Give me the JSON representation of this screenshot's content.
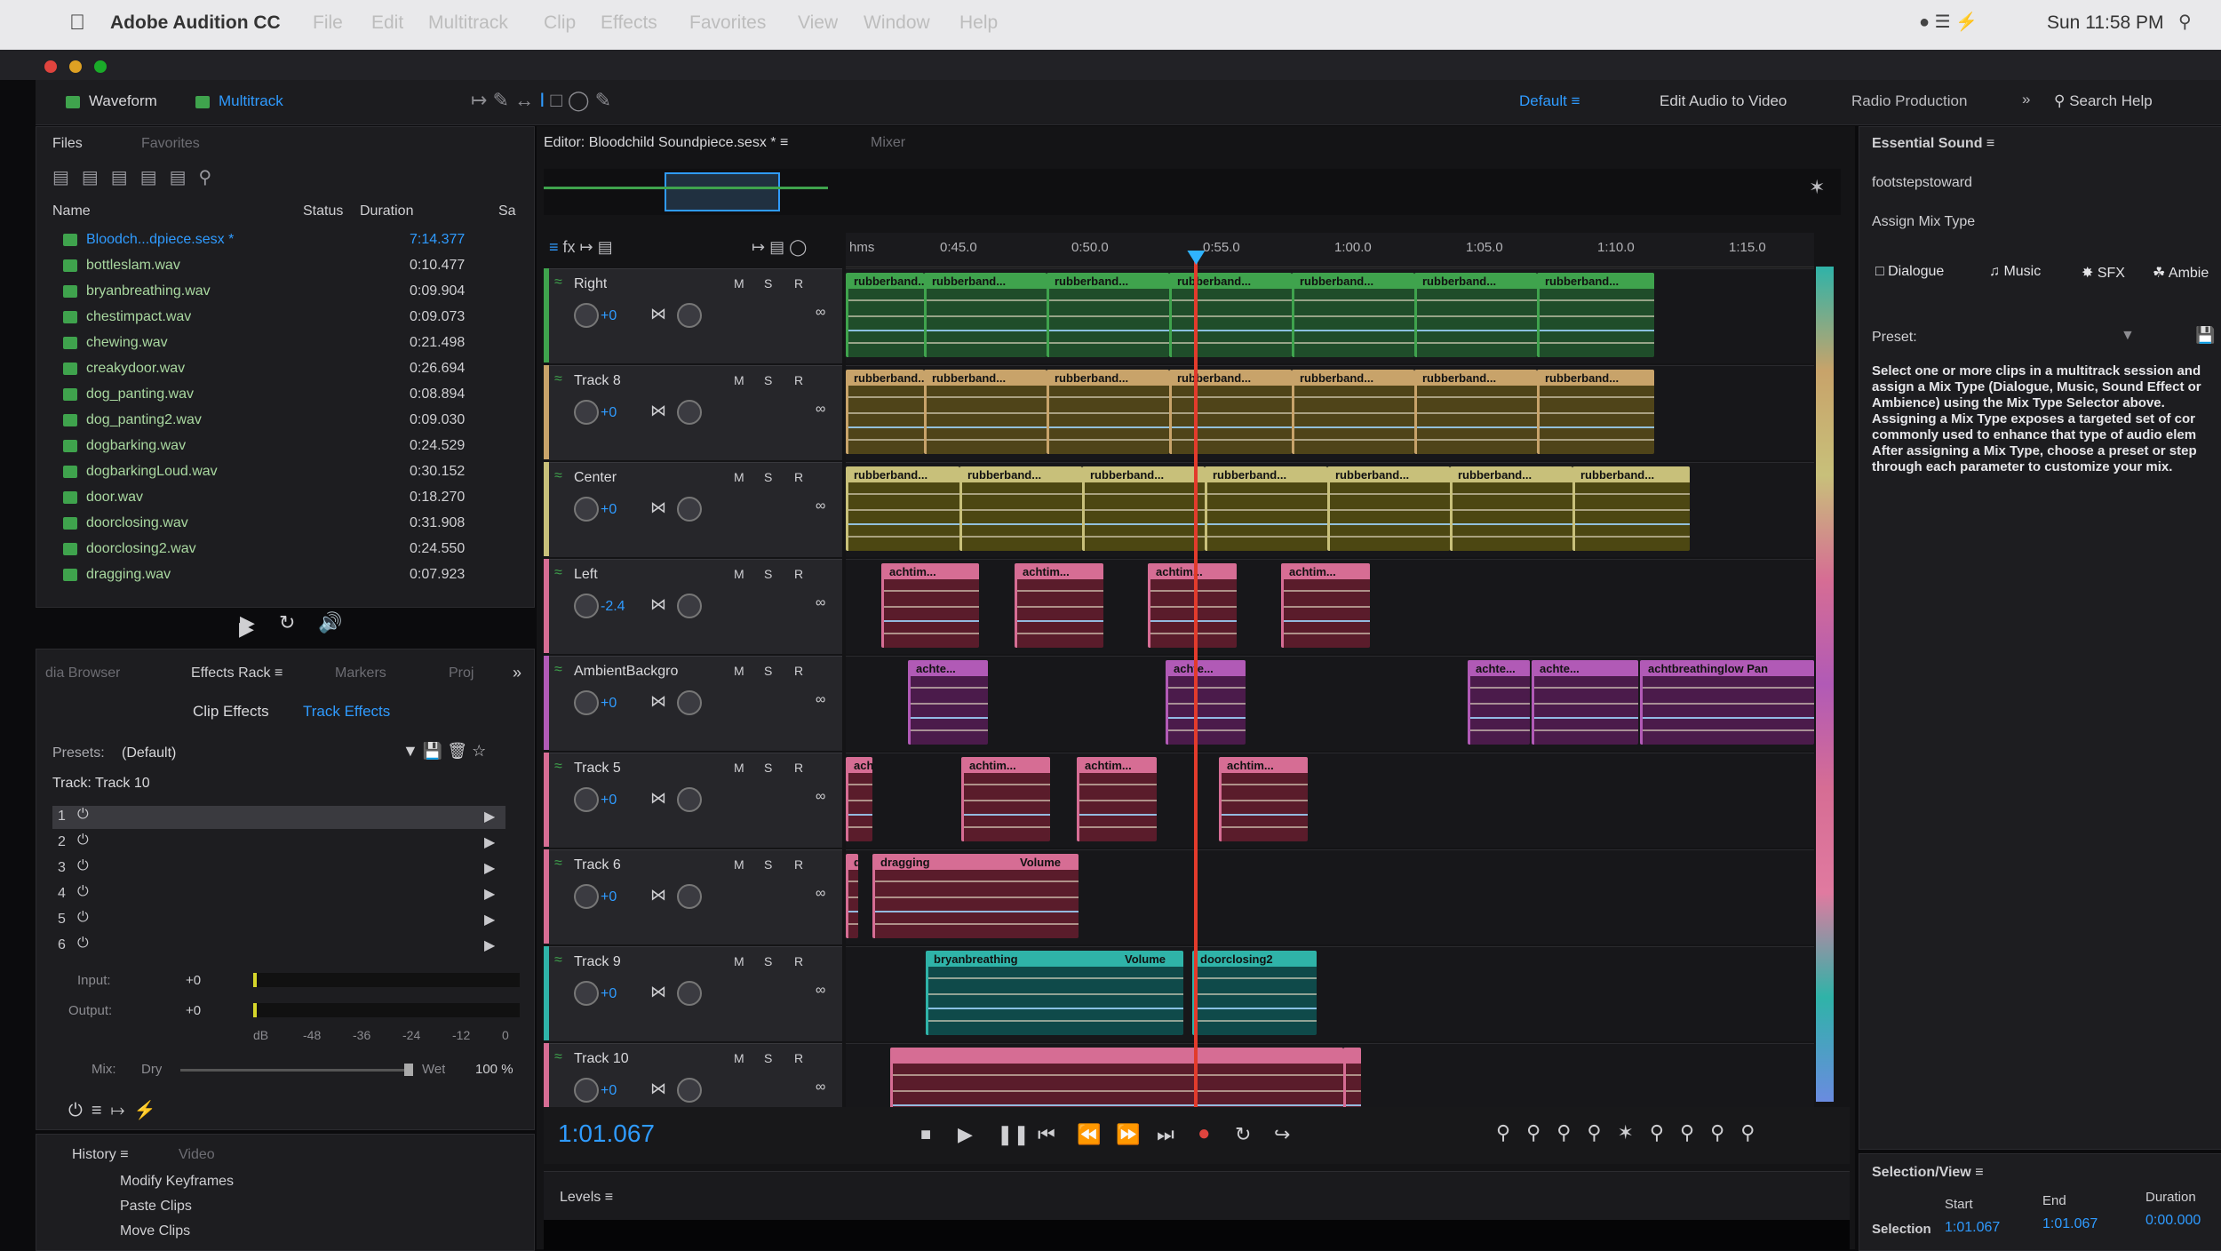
{
  "menubar": {
    "app": "Adobe Audition CC",
    "items": [
      "File",
      "Edit",
      "Multitrack",
      "Clip",
      "Effects",
      "Favorites",
      "View",
      "Window",
      "Help"
    ],
    "clock": "Sun 11:58 PM"
  },
  "toolbar": {
    "waveform": "Waveform",
    "multitrack": "Multitrack",
    "workspace_default": "Default",
    "workspace_edit_video": "Edit Audio to Video",
    "workspace_radio": "Radio Production",
    "search_help": "Search Help"
  },
  "files": {
    "tab_files": "Files",
    "tab_favorites": "Favorites",
    "col_name": "Name",
    "col_status": "Status",
    "col_duration": "Duration",
    "col_sa": "Sa",
    "items": [
      {
        "name": "Bloodch...dpiece.sesx *",
        "duration": "7:14.377"
      },
      {
        "name": "bottleslam.wav",
        "duration": "0:10.477"
      },
      {
        "name": "bryanbreathing.wav",
        "duration": "0:09.904"
      },
      {
        "name": "chestimpact.wav",
        "duration": "0:09.073"
      },
      {
        "name": "chewing.wav",
        "duration": "0:21.498"
      },
      {
        "name": "creakydoor.wav",
        "duration": "0:26.694"
      },
      {
        "name": "dog_panting.wav",
        "duration": "0:08.894"
      },
      {
        "name": "dog_panting2.wav",
        "duration": "0:09.030"
      },
      {
        "name": "dogbarking.wav",
        "duration": "0:24.529"
      },
      {
        "name": "dogbarkingLoud.wav",
        "duration": "0:30.152"
      },
      {
        "name": "door.wav",
        "duration": "0:18.270"
      },
      {
        "name": "doorclosing.wav",
        "duration": "0:31.908"
      },
      {
        "name": "doorclosing2.wav",
        "duration": "0:24.550"
      },
      {
        "name": "dragging.wav",
        "duration": "0:07.923"
      }
    ]
  },
  "effects": {
    "tab_media": "dia Browser",
    "tab_rack": "Effects Rack",
    "tab_markers": "Markers",
    "tab_proj": "Proj",
    "clip_effects": "Clip Effects",
    "track_effects": "Track Effects",
    "presets_label": "Presets:",
    "presets_value": "(Default)",
    "track_label": "Track: Track 10",
    "slots": [
      "1",
      "2",
      "3",
      "4",
      "5",
      "6"
    ],
    "input_label": "Input:",
    "input_val": "+0",
    "output_label": "Output:",
    "output_val": "+0",
    "meter_ticks": [
      "dB",
      "-48",
      "-36",
      "-24",
      "-12",
      "0"
    ],
    "mix_label": "Mix:",
    "mix_dry": "Dry",
    "mix_wet": "Wet",
    "mix_pct": "100 %"
  },
  "history": {
    "tab_history": "History",
    "tab_video": "Video",
    "items": [
      "Modify Keyframes",
      "Paste Clips",
      "Move Clips"
    ]
  },
  "editor": {
    "title": "Editor: Bloodchild Soundpiece.sesx *",
    "mixer": "Mixer",
    "ruler": [
      "hms",
      "0:45.0",
      "0:50.0",
      "0:55.0",
      "1:00.0",
      "1:05.0",
      "1:10.0",
      "1:15.0"
    ],
    "time": "1:01.067",
    "levels": "Levels",
    "playhead_fraction": 0.36,
    "tracks": [
      {
        "name": "Right",
        "vol": "+0",
        "color": "#3fa34d",
        "clip_color": "#1f4d2a",
        "clip_label": "rubberband..."
      },
      {
        "name": "Track 8",
        "vol": "+0",
        "color": "#c8a36a",
        "clip_color": "#4f4419",
        "clip_label": "rubberband..."
      },
      {
        "name": "Center",
        "vol": "+0",
        "color": "#c8c07a",
        "clip_color": "#4c4712",
        "clip_label": "rubberband..."
      },
      {
        "name": "Left",
        "vol": "-2.4",
        "color": "#d66d94",
        "clip_color": "#5a1c2b",
        "clip_label": "achtim..."
      },
      {
        "name": "AmbientBackgro",
        "vol": "+0",
        "color": "#b15ab6",
        "clip_color": "#4b1b4b",
        "clip_label": "achte..."
      },
      {
        "name": "Track 5",
        "vol": "+0",
        "color": "#d66d94",
        "clip_color": "#5a1c2b",
        "clip_label": "achtim..."
      },
      {
        "name": "Track 6",
        "vol": "+0",
        "color": "#d66d94",
        "clip_color": "#5a1c2b",
        "clip_label": "dragging"
      },
      {
        "name": "Track 9",
        "vol": "+0",
        "color": "#2fb3a8",
        "clip_color": "#0f4a4a",
        "clip_label": "bryanbreathing"
      },
      {
        "name": "Track 10",
        "vol": "+0",
        "color": "#d66d94",
        "clip_color": "#5a1c2b",
        "clip_label": ""
      }
    ],
    "track_btns": [
      "M",
      "S",
      "R"
    ],
    "extra_labels": {
      "amb_long": "achtbreathinglow Pan",
      "t6_volume": "Volume",
      "t9_volume": "Volume",
      "t9_second": "doorclosing2"
    }
  },
  "essential_sound": {
    "title": "Essential Sound",
    "clip": "footstepstoward",
    "assign": "Assign Mix Type",
    "dialogue": "Dialogue",
    "music": "Music",
    "sfx": "SFX",
    "ambience": "Ambie",
    "preset_label": "Preset:",
    "description": "Select one or more clips in a multitrack session and assign a Mix Type (Dialogue, Music, Sound Effect or Ambience) using the Mix Type Selector above. Assigning a Mix Type exposes a targeted set of cor commonly used to enhance that type of audio elem After assigning a Mix Type, choose a preset or step through each parameter to customize your mix."
  },
  "selection_view": {
    "title": "Selection/View",
    "start": "Start",
    "end": "End",
    "duration": "Duration",
    "selection": "Selection",
    "sel_start": "1:01.067",
    "sel_end": "1:01.067",
    "sel_dur": "0:00.000"
  }
}
